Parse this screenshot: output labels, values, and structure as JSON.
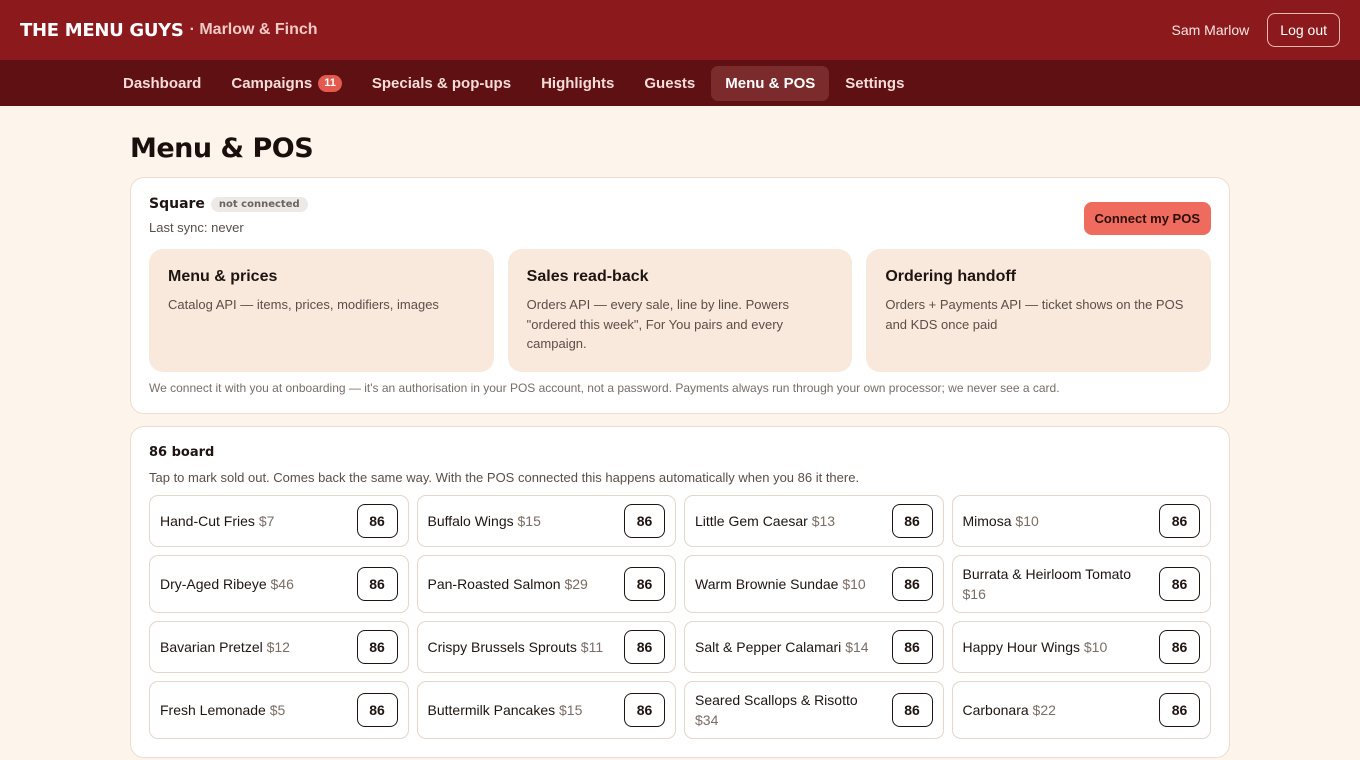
{
  "brand": {
    "name": "THE MENU GUYS",
    "sub": "· Marlow & Finch"
  },
  "user": {
    "name": "Sam Marlow",
    "logout_label": "Log out"
  },
  "nav": [
    {
      "label": "Dashboard"
    },
    {
      "label": "Campaigns",
      "badge": "11"
    },
    {
      "label": "Specials & pop-ups"
    },
    {
      "label": "Highlights"
    },
    {
      "label": "Guests"
    },
    {
      "label": "Menu & POS",
      "active": true
    },
    {
      "label": "Settings"
    }
  ],
  "page_title": "Menu & POS",
  "pos": {
    "provider": "Square",
    "status": "not connected",
    "last_sync": "Last sync: never",
    "connect_label": "Connect my POS",
    "features": [
      {
        "title": "Menu & prices",
        "desc": "Catalog API — items, prices, modifiers, images"
      },
      {
        "title": "Sales read-back",
        "desc": "Orders API — every sale, line by line. Powers \"ordered this week\", For You pairs and every campaign."
      },
      {
        "title": "Ordering handoff",
        "desc": "Orders + Payments API — ticket shows on the POS and KDS once paid"
      }
    ],
    "footnote": "We connect it with you at onboarding — it's an authorisation in your POS account, not a password. Payments always run through your own processor; we never see a card."
  },
  "board": {
    "title": "86 board",
    "desc": "Tap to mark sold out. Comes back the same way. With the POS connected this happens automatically when you 86 it there.",
    "button_label": "86",
    "items": [
      {
        "name": "Hand-Cut Fries",
        "price": "$7"
      },
      {
        "name": "Buffalo Wings",
        "price": "$15"
      },
      {
        "name": "Little Gem Caesar",
        "price": "$13"
      },
      {
        "name": "Mimosa",
        "price": "$10"
      },
      {
        "name": "Dry-Aged Ribeye",
        "price": "$46"
      },
      {
        "name": "Pan-Roasted Salmon",
        "price": "$29"
      },
      {
        "name": "Warm Brownie Sundae",
        "price": "$10"
      },
      {
        "name": "Burrata & Heirloom Tomato",
        "price": "$16"
      },
      {
        "name": "Bavarian Pretzel",
        "price": "$12"
      },
      {
        "name": "Crispy Brussels Sprouts",
        "price": "$11"
      },
      {
        "name": "Salt & Pepper Calamari",
        "price": "$14"
      },
      {
        "name": "Happy Hour Wings",
        "price": "$10"
      },
      {
        "name": "Fresh Lemonade",
        "price": "$5"
      },
      {
        "name": "Buttermilk Pancakes",
        "price": "$15"
      },
      {
        "name": "Seared Scallops & Risotto",
        "price": "$34"
      },
      {
        "name": "Carbonara",
        "price": "$22"
      }
    ]
  }
}
